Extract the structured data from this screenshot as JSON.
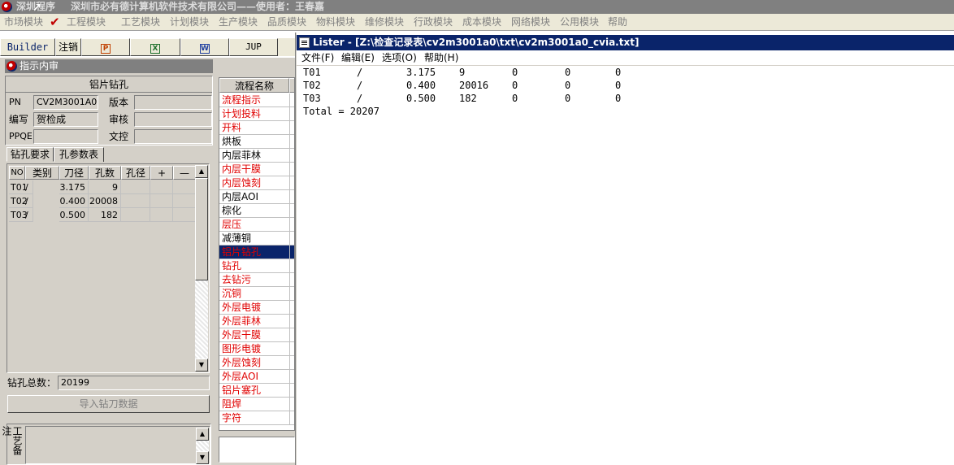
{
  "titlebar": {
    "app_title": "深圳程序",
    "company": "深圳市必有德计算机软件技术有限公司——使用者：王春嘉"
  },
  "menubar": {
    "items": [
      "市场模块",
      "工程模块",
      "工艺模块",
      "计划模块",
      "生产模块",
      "品质模块",
      "物料模块",
      "维修模块",
      "行政模块",
      "成本模块",
      "网络模块",
      "公用模块",
      "帮助"
    ]
  },
  "toolbar": {
    "builder": "Builder",
    "logout": "注销",
    "jup": "JUP"
  },
  "panel": {
    "header": "指示内审",
    "section_title": "铝片钻孔",
    "pn_label": "PN",
    "pn_value": "CV2M3001A0",
    "version_label": "版本",
    "version_value": "",
    "author_label": "编写",
    "author_value": "贺检成",
    "review_label": "审核",
    "review_value": "",
    "ppqe_label": "PPQE",
    "ppqe_value": "",
    "doc_label": "文控",
    "doc_value": "",
    "tabs": [
      "钻孔要求",
      "孔参数表"
    ],
    "grid_headers": [
      "NO",
      "类别",
      "刀径",
      "孔数",
      "孔径",
      "+",
      "—"
    ],
    "grid_rows": [
      {
        "no": "T01",
        "type": "/",
        "dia": "3.175",
        "count": "9"
      },
      {
        "no": "T02",
        "type": "/",
        "dia": "0.400",
        "count": "20008"
      },
      {
        "no": "T03",
        "type": "/",
        "dia": "0.500",
        "count": "182"
      }
    ],
    "total_label": "钻孔总数：",
    "total_value": "20199",
    "import_button": "导入钻刀数据",
    "notes_label": "工艺备注"
  },
  "process": {
    "header": "流程名称",
    "items": [
      {
        "name": "流程指示",
        "red": true
      },
      {
        "name": "计划投料",
        "red": true
      },
      {
        "name": "开料",
        "red": true
      },
      {
        "name": "烘板",
        "red": false
      },
      {
        "name": "内层菲林",
        "red": false
      },
      {
        "name": "内层干膜",
        "red": true
      },
      {
        "name": "内层蚀刻",
        "red": true
      },
      {
        "name": "内层AOI",
        "red": false
      },
      {
        "name": "棕化",
        "red": false
      },
      {
        "name": "层压",
        "red": true
      },
      {
        "name": "减薄铜",
        "red": false
      },
      {
        "name": "铝片钻孔",
        "red": true,
        "selected": true
      },
      {
        "name": "钻孔",
        "red": true
      },
      {
        "name": "去钻污",
        "red": true
      },
      {
        "name": "沉铜",
        "red": true
      },
      {
        "name": "外层电镀",
        "red": true
      },
      {
        "name": "外层菲林",
        "red": true
      },
      {
        "name": "外层干膜",
        "red": true
      },
      {
        "name": "图形电镀",
        "red": true
      },
      {
        "name": "外层蚀刻",
        "red": true
      },
      {
        "name": "外层AOI",
        "red": true
      },
      {
        "name": "铝片塞孔",
        "red": true
      },
      {
        "name": "阻焊",
        "red": true
      },
      {
        "name": "字符",
        "red": true
      }
    ]
  },
  "lister": {
    "title": "Lister - [Z:\\检查记录表\\cv2m3001a0\\txt\\cv2m3001a0_cvia.txt]",
    "menu": [
      "文件(F)",
      "编辑(E)",
      "选项(O)",
      "帮助(H)"
    ],
    "lines": [
      [
        "T01",
        "/",
        "3.175",
        "9",
        "0",
        "0",
        "0"
      ],
      [
        "T02",
        "/",
        "0.400",
        "20016",
        "0",
        "0",
        "0"
      ],
      [
        "T03",
        "/",
        "0.500",
        "182",
        "0",
        "0",
        "0"
      ]
    ],
    "total_line": "Total = 20207"
  },
  "colors": {
    "title_active": "#0a246a",
    "red_text": "#e00000",
    "selected_bg": "#0a246a"
  }
}
